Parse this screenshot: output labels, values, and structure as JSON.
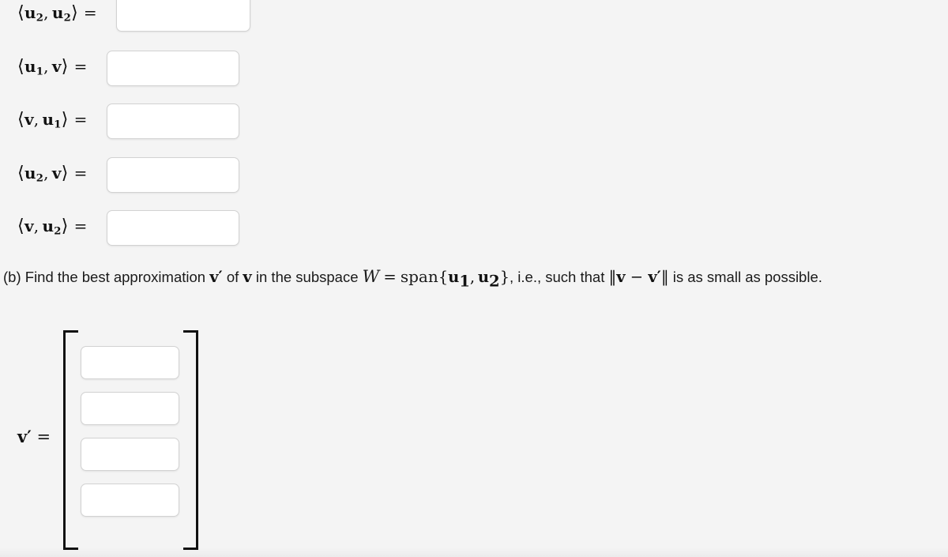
{
  "page": {
    "background_color": "#f4f4f4",
    "text_color": "#1a1a1a"
  },
  "inner_products": {
    "rows": [
      {
        "id": "u2-u2",
        "label_html_parts": {
          "open": "⟨",
          "first": "u",
          "first_sub": "2",
          "comma": ",",
          "second": "u",
          "second_sub": "2",
          "close": "⟩",
          "equals": "="
        },
        "label_text": "⟨u₂ , u₂⟩ =",
        "input_value": "",
        "input_placeholder": ""
      },
      {
        "id": "u1-v",
        "label_html_parts": {
          "open": "⟨",
          "first": "u",
          "first_sub": "1",
          "comma": ",",
          "second": "v",
          "second_sub": "",
          "close": "⟩",
          "equals": "="
        },
        "label_text": "⟨u₁ , v⟩ =",
        "input_value": "",
        "input_placeholder": ""
      },
      {
        "id": "v-u1",
        "label_html_parts": {
          "open": "⟨",
          "first": "v",
          "first_sub": "",
          "comma": ",",
          "second": "u",
          "second_sub": "1",
          "close": "⟩",
          "equals": "="
        },
        "label_text": "⟨v, u₁⟩ =",
        "input_value": "",
        "input_placeholder": ""
      },
      {
        "id": "u2-v",
        "label_html_parts": {
          "open": "⟨",
          "first": "u",
          "first_sub": "2",
          "comma": ",",
          "second": "v",
          "second_sub": "",
          "close": "⟩",
          "equals": "="
        },
        "label_text": "⟨u₂ , v⟩ =",
        "input_value": "",
        "input_placeholder": ""
      },
      {
        "id": "v-u2",
        "label_html_parts": {
          "open": "⟨",
          "first": "v",
          "first_sub": "",
          "comma": ",",
          "second": "u",
          "second_sub": "2",
          "close": "⟩",
          "equals": "="
        },
        "label_text": "⟨v, u₂⟩ =",
        "input_value": "",
        "input_placeholder": ""
      }
    ]
  },
  "statement_b": {
    "part_label": "(b)",
    "lead": "Find the best approximation",
    "v_prime": "v′",
    "of": "of",
    "v": "v",
    "mid": "in the subspace",
    "W": "W",
    "equals": "=",
    "span_word": "span",
    "span_open": "{",
    "span_u1": "u",
    "span_u1_sub": "1",
    "span_comma": ",",
    "span_u2": "u",
    "span_u2_sub": "2",
    "span_close": "}",
    "ie": ", i.e., such that",
    "norm_open": "‖",
    "norm_v": "v",
    "norm_minus": "−",
    "norm_vprime": "v′",
    "norm_close": "‖",
    "tail": "is as small as possible.",
    "full_text": "(b) Find the best approximation v′ of v in the subspace W = span{u₁ , u₂ }, i.e., such that ‖v − v′‖ is as small as possible."
  },
  "answer_vector": {
    "label": "v′",
    "equals": "=",
    "bracket_left": "[",
    "bracket_right": "]",
    "entries": [
      {
        "id": "vprime-1",
        "input_value": "",
        "input_placeholder": ""
      },
      {
        "id": "vprime-2",
        "input_value": "",
        "input_placeholder": ""
      },
      {
        "id": "vprime-3",
        "input_value": "",
        "input_placeholder": ""
      },
      {
        "id": "vprime-4",
        "input_value": "",
        "input_placeholder": ""
      }
    ]
  }
}
